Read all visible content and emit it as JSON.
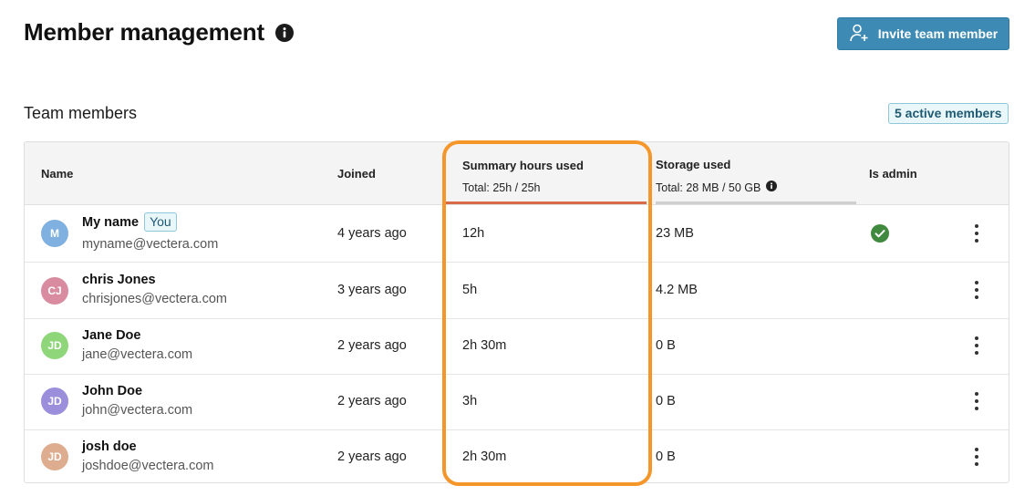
{
  "header": {
    "title": "Member management",
    "invite_label": "Invite team member"
  },
  "section": {
    "title": "Team members",
    "active_badge": "5 active members"
  },
  "table": {
    "columns": {
      "name": "Name",
      "joined": "Joined",
      "summary": "Summary hours used",
      "summary_total": "Total: 25h / 25h",
      "storage": "Storage used",
      "storage_total": "Total: 28 MB / 50 GB",
      "admin": "Is admin"
    },
    "rows": [
      {
        "initials": "M",
        "avatar_color": "#7fb0e0",
        "name": "My name",
        "you_badge": "You",
        "email": "myname@vectera.com",
        "joined": "4 years ago",
        "summary": "12h",
        "storage": "23 MB",
        "is_admin": true
      },
      {
        "initials": "CJ",
        "avatar_color": "#d98ca0",
        "name": "chris Jones",
        "email": "chrisjones@vectera.com",
        "joined": "3 years ago",
        "summary": "5h",
        "storage": "4.2 MB",
        "is_admin": false
      },
      {
        "initials": "JD",
        "avatar_color": "#8fd67a",
        "name": "Jane Doe",
        "email": "jane@vectera.com",
        "joined": "2 years ago",
        "summary": "2h 30m",
        "storage": "0 B",
        "is_admin": false
      },
      {
        "initials": "JD",
        "avatar_color": "#9b8fdc",
        "name": "John Doe",
        "email": "john@vectera.com",
        "joined": "2 years ago",
        "summary": "3h",
        "storage": "0 B",
        "is_admin": false
      },
      {
        "initials": "JD",
        "avatar_color": "#deac8e",
        "name": "josh doe",
        "email": "joshdoe@vectera.com",
        "joined": "2 years ago",
        "summary": "2h 30m",
        "storage": "0 B",
        "is_admin": false
      }
    ]
  },
  "colors": {
    "accent": "#3d8bb4",
    "highlight": "#f5962b",
    "sort_indicator": "#d86b47",
    "admin_check": "#3f8a3f"
  },
  "icons": {
    "title_info": "info-icon",
    "invite": "add-user-icon",
    "storage_info": "info-icon",
    "admin": "check-circle-icon",
    "row_menu": "kebab-menu-icon"
  }
}
